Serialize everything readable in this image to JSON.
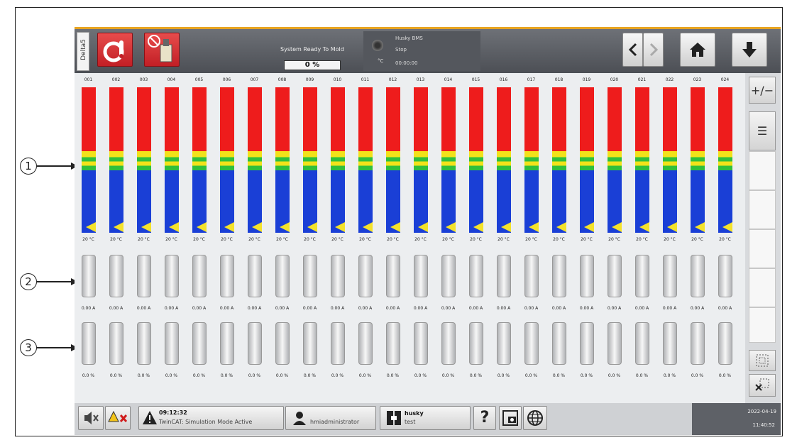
{
  "topbar": {
    "tab_label": "Delta5",
    "status_text": "System Ready To Mold",
    "progress_text": "0 %",
    "machine_name": "Husky BMS",
    "machine_state": "Stop",
    "machine_time": "00:00:00",
    "unit": "°C",
    "accent_color": "#e8a422"
  },
  "channels": [
    {
      "label": "001",
      "temp": "20 °C",
      "amps": "0.00 A",
      "power": "0.0 %"
    },
    {
      "label": "002",
      "temp": "20 °C",
      "amps": "0.00 A",
      "power": "0.0 %"
    },
    {
      "label": "003",
      "temp": "20 °C",
      "amps": "0.00 A",
      "power": "0.0 %"
    },
    {
      "label": "004",
      "temp": "20 °C",
      "amps": "0.00 A",
      "power": "0.0 %"
    },
    {
      "label": "005",
      "temp": "20 °C",
      "amps": "0.00 A",
      "power": "0.0 %"
    },
    {
      "label": "006",
      "temp": "20 °C",
      "amps": "0.00 A",
      "power": "0.0 %"
    },
    {
      "label": "007",
      "temp": "20 °C",
      "amps": "0.00 A",
      "power": "0.0 %"
    },
    {
      "label": "008",
      "temp": "20 °C",
      "amps": "0.00 A",
      "power": "0.0 %"
    },
    {
      "label": "009",
      "temp": "20 °C",
      "amps": "0.00 A",
      "power": "0.0 %"
    },
    {
      "label": "010",
      "temp": "20 °C",
      "amps": "0.00 A",
      "power": "0.0 %"
    },
    {
      "label": "011",
      "temp": "20 °C",
      "amps": "0.00 A",
      "power": "0.0 %"
    },
    {
      "label": "012",
      "temp": "20 °C",
      "amps": "0.00 A",
      "power": "0.0 %"
    },
    {
      "label": "013",
      "temp": "20 °C",
      "amps": "0.00 A",
      "power": "0.0 %"
    },
    {
      "label": "014",
      "temp": "20 °C",
      "amps": "0.00 A",
      "power": "0.0 %"
    },
    {
      "label": "015",
      "temp": "20 °C",
      "amps": "0.00 A",
      "power": "0.0 %"
    },
    {
      "label": "016",
      "temp": "20 °C",
      "amps": "0.00 A",
      "power": "0.0 %"
    },
    {
      "label": "017",
      "temp": "20 °C",
      "amps": "0.00 A",
      "power": "0.0 %"
    },
    {
      "label": "018",
      "temp": "20 °C",
      "amps": "0.00 A",
      "power": "0.0 %"
    },
    {
      "label": "019",
      "temp": "20 °C",
      "amps": "0.00 A",
      "power": "0.0 %"
    },
    {
      "label": "020",
      "temp": "20 °C",
      "amps": "0.00 A",
      "power": "0.0 %"
    },
    {
      "label": "021",
      "temp": "20 °C",
      "amps": "0.00 A",
      "power": "0.0 %"
    },
    {
      "label": "022",
      "temp": "20 °C",
      "amps": "0.00 A",
      "power": "0.0 %"
    },
    {
      "label": "023",
      "temp": "20 °C",
      "amps": "0.00 A",
      "power": "0.0 %"
    },
    {
      "label": "024",
      "temp": "20 °C",
      "amps": "0.00 A",
      "power": "0.0 %"
    }
  ],
  "right_panel": {
    "plus_minus": "+/−",
    "menu": "☰"
  },
  "bottombar": {
    "alarm_time": "09:12:32",
    "alarm_text": "TwinCAT: Simulation Mode Active",
    "user": "hmiadministrator",
    "mold_name": "husky",
    "mold_sub": "test",
    "help": "?",
    "date": "2022-04-19",
    "time": "11:40:52"
  },
  "callouts": [
    "1",
    "2",
    "3"
  ],
  "colors": {
    "high": "#ee1c1c",
    "warn": "#f2e21a",
    "ok": "#2fbf3c",
    "low": "#1a3fd6",
    "brand_red": "#c21f25"
  }
}
